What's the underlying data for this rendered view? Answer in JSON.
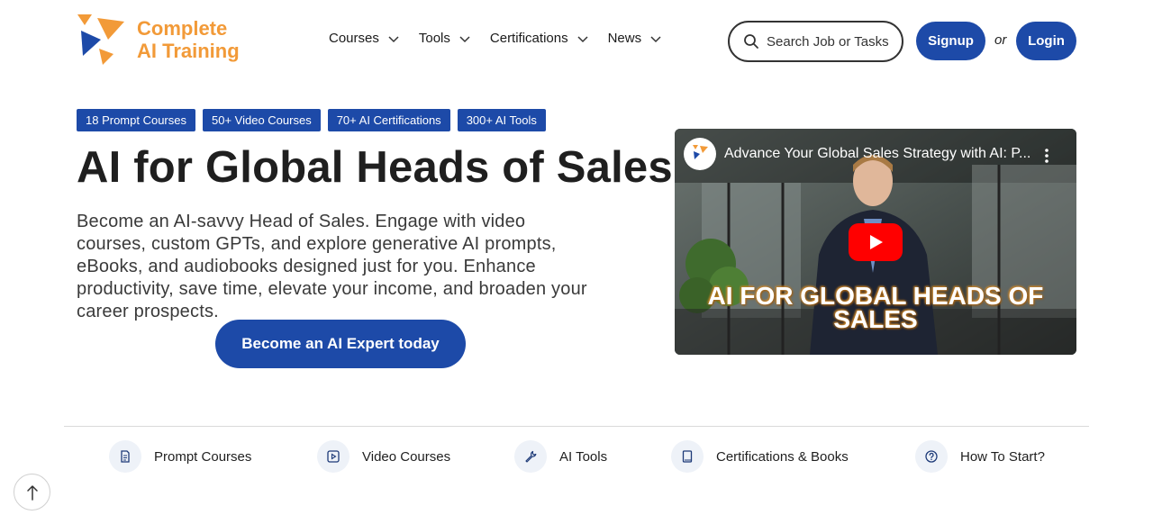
{
  "logo": {
    "line1": "Complete",
    "line2": "AI Training"
  },
  "nav": [
    {
      "label": "Courses"
    },
    {
      "label": "Tools"
    },
    {
      "label": "Certifications"
    },
    {
      "label": "News"
    }
  ],
  "search": {
    "placeholder": "Search Job or Tasks"
  },
  "auth": {
    "signup": "Signup",
    "or": "or",
    "login": "Login"
  },
  "badges": [
    "18 Prompt Courses",
    "50+ Video Courses",
    "70+ AI Certifications",
    "300+ AI Tools"
  ],
  "hero": {
    "title": "AI for Global Heads of Sales",
    "description": "Become an AI-savvy Head of Sales. Engage with video courses, custom GPTs, and explore generative AI prompts, eBooks, and audiobooks designed just for you. Enhance productivity, save time, elevate your income, and broaden your career prospects.",
    "cta": "Become an AI Expert today"
  },
  "video": {
    "title": "Advance Your Global Sales Strategy with AI: P...",
    "caption_line1": "AI FOR GLOBAL HEADS OF",
    "caption_line2": "SALES"
  },
  "bottom_nav": [
    {
      "label": "Prompt Courses",
      "icon": "document-icon"
    },
    {
      "label": "Video Courses",
      "icon": "play-square-icon"
    },
    {
      "label": "AI Tools",
      "icon": "wrench-icon"
    },
    {
      "label": "Certifications & Books",
      "icon": "book-icon"
    },
    {
      "label": "How To Start?",
      "icon": "question-circle-icon"
    }
  ],
  "colors": {
    "primary": "#1d4aa8",
    "logo_orange": "#f29a38",
    "logo_blue": "#1d4aa8"
  }
}
